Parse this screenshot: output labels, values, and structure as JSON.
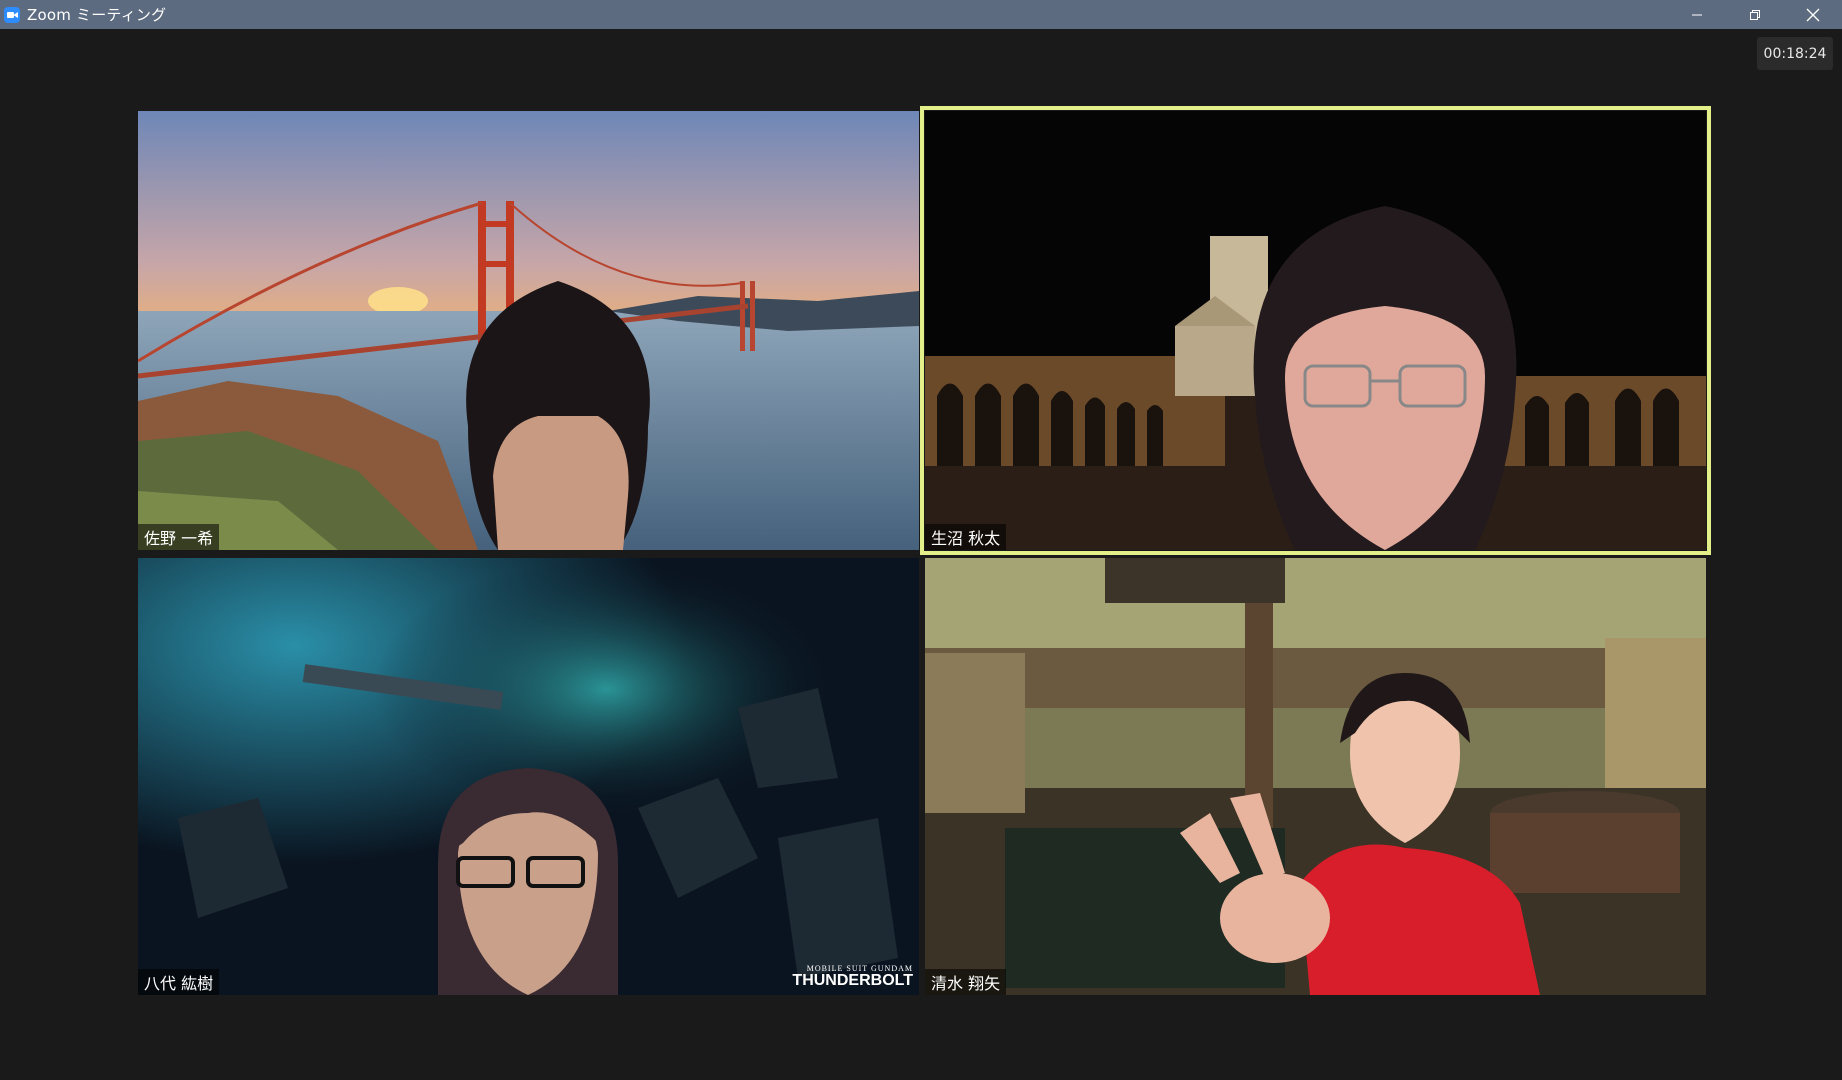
{
  "window": {
    "title": "Zoom ミーティング",
    "app_icon": "zoom-camera-icon",
    "controls": [
      "minimize-icon",
      "restore-icon",
      "close-icon"
    ]
  },
  "meeting": {
    "timer": "00:18:24"
  },
  "participants": [
    {
      "name": "佐野 一希",
      "background": "golden-gate-bridge",
      "active_speaker": false
    },
    {
      "name": "生沼 秋太",
      "background": "night-basilica-arcade",
      "active_speaker": true
    },
    {
      "name": "八代 紘樹",
      "background": "space-asteroid-field",
      "active_speaker": false
    },
    {
      "name": "清水 翔矢",
      "background": "outdoor-onsen",
      "active_speaker": false
    }
  ],
  "watermark": {
    "line1": "MOBILE SUIT GUNDAM",
    "line2": "THUNDERBOLT"
  },
  "colors": {
    "titlebar": "#5c6b80",
    "background": "#1a1a1a",
    "active_speaker_border": "#e3f08a"
  }
}
